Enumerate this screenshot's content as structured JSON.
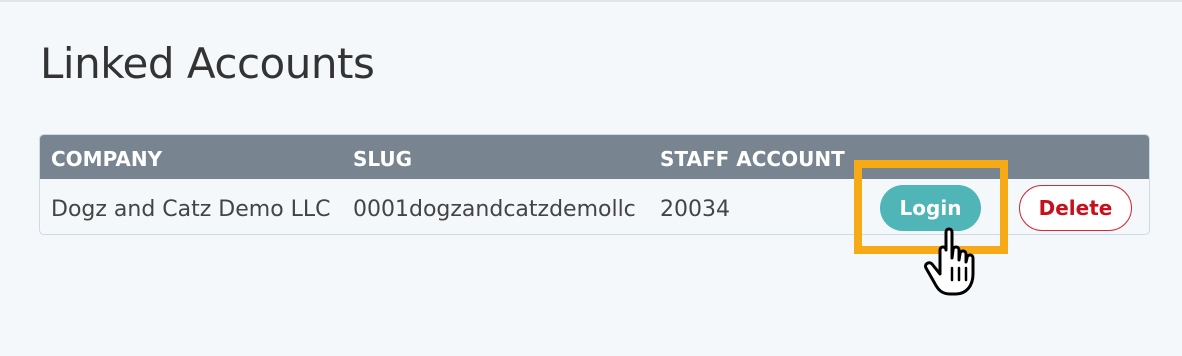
{
  "page": {
    "title": "Linked Accounts"
  },
  "table": {
    "headers": {
      "company": "COMPANY",
      "slug": "SLUG",
      "staff_account": "STAFF ACCOUNT"
    },
    "rows": [
      {
        "company": "Dogz and Catz Demo LLC",
        "slug": "0001dogzandcatzdemollc",
        "staff_account": "20034",
        "login_label": "Login",
        "delete_label": "Delete"
      }
    ]
  },
  "colors": {
    "header_bg": "#788591",
    "login_accent": "#4fb5b6",
    "delete_accent": "#c8101d",
    "highlight": "#f6aa16"
  },
  "icons": {
    "cursor": "hand-pointer-icon"
  }
}
